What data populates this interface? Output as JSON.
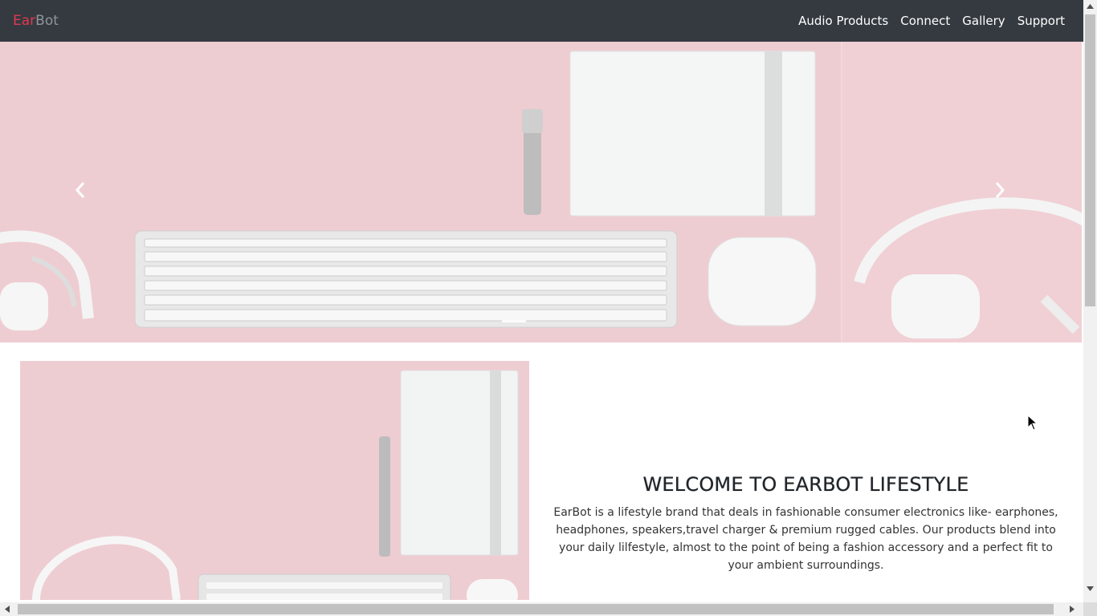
{
  "brand": {
    "part1": "Ear",
    "part2": "Bot"
  },
  "nav": [
    "Audio Products",
    "Connect",
    "Gallery",
    "Support"
  ],
  "carousel": {
    "prev_icon": "chevron-left-icon",
    "next_icon": "chevron-right-icon",
    "indicator_count": 1
  },
  "welcome": {
    "title": "WELCOME TO EARBOT LIFESTYLE",
    "body": "EarBot is a lifestyle brand that deals in fashionable consumer electronics like- earphones, headphones, speakers,travel charger & premium rugged cables. Our products blend into your daily lilfestyle, almost to the point of being a fashion accessory and a perfect fit to your ambient surroundings."
  },
  "colors": {
    "navbar": "#343a40",
    "brand_accent": "#e0394f",
    "brand_muted": "#8f959b",
    "hero_bg": "#eecdd2"
  }
}
